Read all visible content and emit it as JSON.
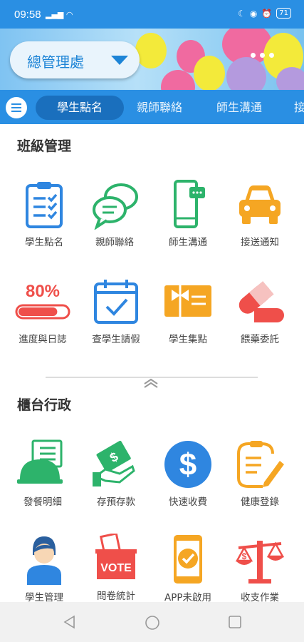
{
  "status_bar": {
    "time": "09:58",
    "battery": "71"
  },
  "header": {
    "location_select": "總管理處"
  },
  "tabs": [
    "學生點名",
    "親師聯絡",
    "師生溝通",
    "接"
  ],
  "sections": [
    {
      "title": "班級管理",
      "items": [
        {
          "label": "學生點名",
          "icon": "clipboard-check-icon"
        },
        {
          "label": "親師聯絡",
          "icon": "chat-bubbles-icon"
        },
        {
          "label": "師生溝通",
          "icon": "phone-message-icon"
        },
        {
          "label": "接送通知",
          "icon": "car-icon"
        },
        {
          "label": "進度與日誌",
          "icon": "progress-bar-icon",
          "badge": "80%",
          "progress": 0.8
        },
        {
          "label": "查學生請假",
          "icon": "calendar-check-icon"
        },
        {
          "label": "學生集點",
          "icon": "gift-card-icon"
        },
        {
          "label": "餵藥委託",
          "icon": "pill-icon"
        }
      ]
    },
    {
      "title": "櫃台行政",
      "items": [
        {
          "label": "發餐明細",
          "icon": "meal-cloche-icon"
        },
        {
          "label": "存預存款",
          "icon": "money-hand-icon"
        },
        {
          "label": "快速收費",
          "icon": "dollar-coin-icon"
        },
        {
          "label": "健康登錄",
          "icon": "clipboard-pen-icon"
        },
        {
          "label": "學生管理",
          "icon": "student-avatar-icon"
        },
        {
          "label": "問卷統計",
          "icon": "vote-box-icon",
          "badge": "VOTE"
        },
        {
          "label": "APP未啟用",
          "icon": "phone-check-icon"
        },
        {
          "label": "收支作業",
          "icon": "balance-scale-icon"
        }
      ]
    }
  ],
  "colors": {
    "primary": "#2a8fe3",
    "blue": "#2f86e0",
    "green": "#2db36b",
    "orange": "#f5a623",
    "red": "#ef4f4a"
  }
}
